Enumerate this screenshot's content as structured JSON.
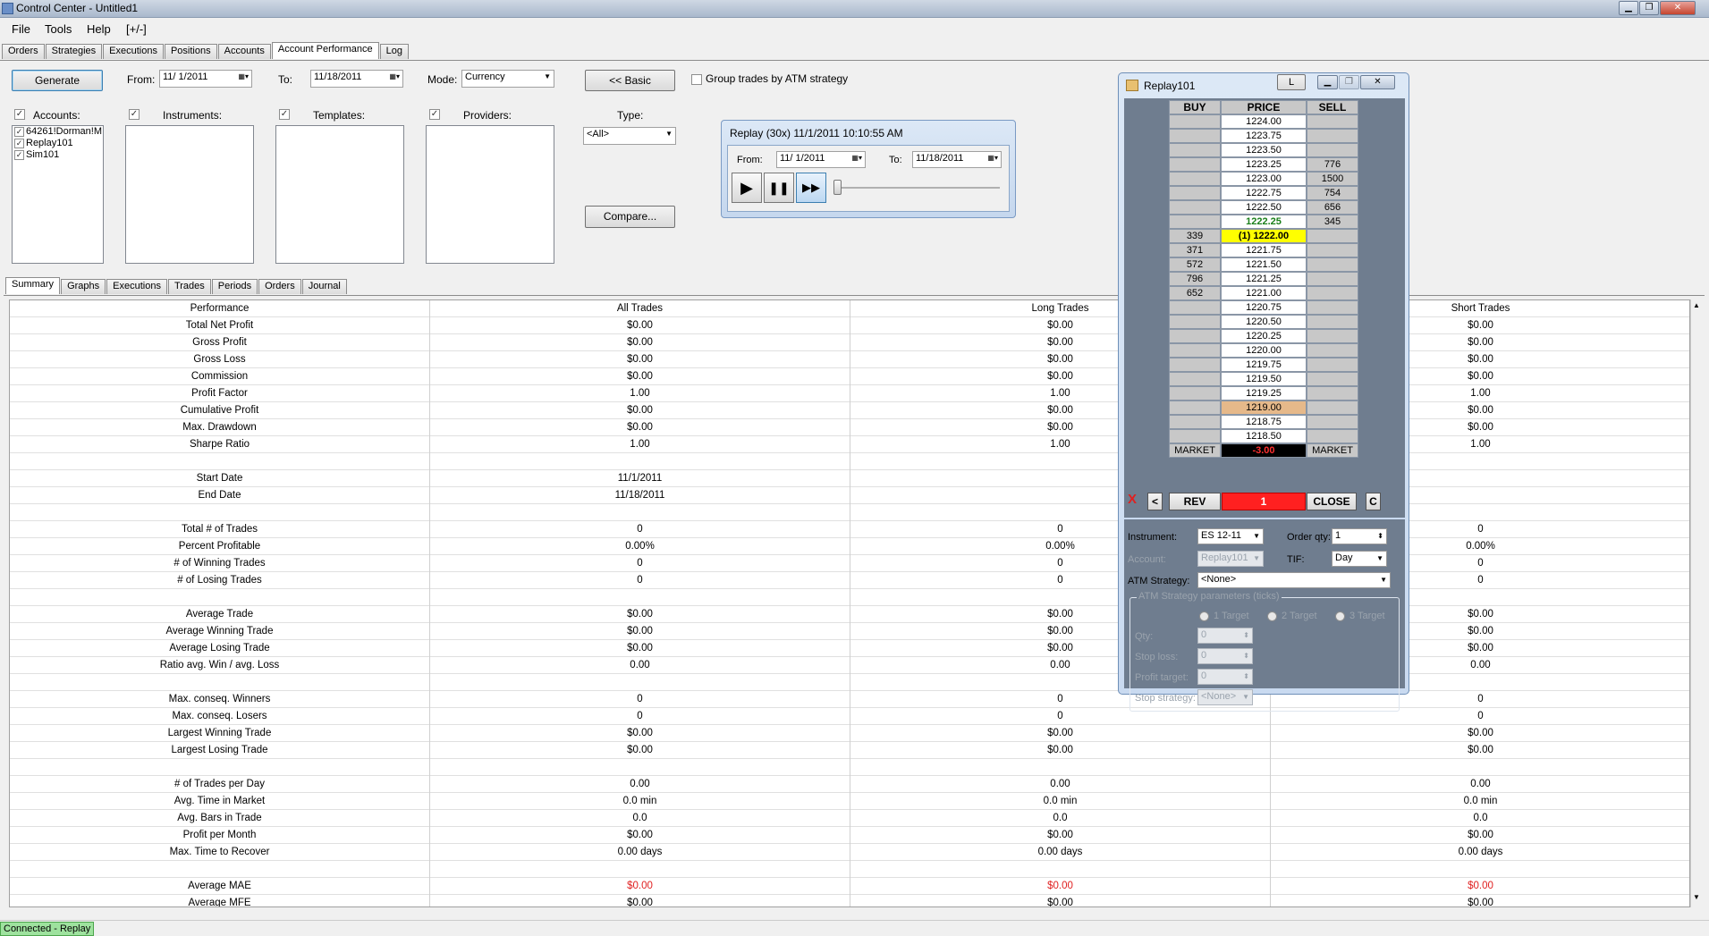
{
  "window": {
    "title": "Control Center - Untitled1",
    "min": "▁",
    "max": "❐",
    "close": "✕"
  },
  "menu": [
    "File",
    "Tools",
    "Help",
    "[+/-]"
  ],
  "main_tabs": [
    "Orders",
    "Strategies",
    "Executions",
    "Positions",
    "Accounts",
    "Account Performance",
    "Log"
  ],
  "toolbar": {
    "generate": "Generate",
    "from_label": "From:",
    "from_value": "11/ 1/2011",
    "to_label": "To:",
    "to_value": "11/18/2011",
    "mode_label": "Mode:",
    "mode_value": "Currency",
    "basic": "<< Basic",
    "group_trades": "Group trades by ATM strategy",
    "type_label": "Type:",
    "type_value": "<All>",
    "compare": "Compare..."
  },
  "filters": {
    "accounts_label": "Accounts:",
    "accounts": [
      "64261!Dorman!M",
      "Replay101",
      "Sim101"
    ],
    "instruments_label": "Instruments:",
    "templates_label": "Templates:",
    "providers_label": "Providers:"
  },
  "replay": {
    "title": "Replay (30x) 11/1/2011 10:10:55 AM",
    "from_label": "From:",
    "from_value": "11/ 1/2011",
    "to_label": "To:",
    "to_value": "11/18/2011",
    "play": "▶",
    "pause": "❚❚",
    "ffwd": "▶▶"
  },
  "sub_tabs": [
    "Summary",
    "Graphs",
    "Executions",
    "Trades",
    "Periods",
    "Orders",
    "Journal"
  ],
  "summary": {
    "headers": [
      "Performance",
      "All Trades",
      "Long Trades",
      "",
      "Short Trades"
    ],
    "rows": [
      [
        "Total Net Profit",
        "$0.00",
        "$0.00",
        "$0.00"
      ],
      [
        "Gross Profit",
        "$0.00",
        "$0.00",
        "$0.00"
      ],
      [
        "Gross Loss",
        "$0.00",
        "$0.00",
        "$0.00"
      ],
      [
        "Commission",
        "$0.00",
        "$0.00",
        "$0.00"
      ],
      [
        "Profit Factor",
        "1.00",
        "1.00",
        "1.00"
      ],
      [
        "Cumulative Profit",
        "$0.00",
        "$0.00",
        "$0.00"
      ],
      [
        "Max. Drawdown",
        "$0.00",
        "$0.00",
        "$0.00"
      ],
      [
        "Sharpe Ratio",
        "1.00",
        "1.00",
        "1.00"
      ],
      [
        "",
        "",
        "",
        ""
      ],
      [
        "Start Date",
        "11/1/2011",
        "",
        ""
      ],
      [
        "End Date",
        "11/18/2011",
        "",
        ""
      ],
      [
        "",
        "",
        "",
        ""
      ],
      [
        "Total # of Trades",
        "0",
        "0",
        "0"
      ],
      [
        "Percent Profitable",
        "0.00%",
        "0.00%",
        "0.00%"
      ],
      [
        "# of Winning Trades",
        "0",
        "0",
        "0"
      ],
      [
        "# of Losing Trades",
        "0",
        "0",
        "0"
      ],
      [
        "",
        "",
        "",
        ""
      ],
      [
        "Average Trade",
        "$0.00",
        "$0.00",
        "$0.00"
      ],
      [
        "Average Winning Trade",
        "$0.00",
        "$0.00",
        "$0.00"
      ],
      [
        "Average Losing Trade",
        "$0.00",
        "$0.00",
        "$0.00"
      ],
      [
        "Ratio avg. Win / avg. Loss",
        "0.00",
        "0.00",
        "0.00"
      ],
      [
        "",
        "",
        "",
        ""
      ],
      [
        "Max. conseq. Winners",
        "0",
        "0",
        "0"
      ],
      [
        "Max. conseq. Losers",
        "0",
        "0",
        "0"
      ],
      [
        "Largest Winning Trade",
        "$0.00",
        "$0.00",
        "$0.00"
      ],
      [
        "Largest Losing Trade",
        "$0.00",
        "$0.00",
        "$0.00"
      ],
      [
        "",
        "",
        "",
        ""
      ],
      [
        "# of Trades per Day",
        "0.00",
        "0.00",
        "0.00"
      ],
      [
        "Avg. Time in Market",
        "0.0 min",
        "0.0 min",
        "0.0 min"
      ],
      [
        "Avg. Bars in Trade",
        "0.0",
        "0.0",
        "0.0"
      ],
      [
        "Profit per Month",
        "$0.00",
        "$0.00",
        "$0.00"
      ],
      [
        "Max. Time to Recover",
        "0.00 days",
        "0.00 days",
        "0.00 days"
      ],
      [
        "",
        "",
        "",
        ""
      ],
      [
        "Average MAE",
        "$0.00",
        "$0.00",
        "$0.00"
      ],
      [
        "Average MFE",
        "$0.00",
        "$0.00",
        "$0.00"
      ]
    ],
    "red_rows": [
      33
    ]
  },
  "status": {
    "connection": "Connected - Replay"
  },
  "dom": {
    "title": "Replay101",
    "link_button": "L",
    "headers": [
      "BUY",
      "PRICE",
      "SELL"
    ],
    "ladder": [
      {
        "buy": "",
        "price": "1224.00",
        "sell": "",
        "style": "white"
      },
      {
        "buy": "",
        "price": "1223.75",
        "sell": "",
        "style": "white"
      },
      {
        "buy": "",
        "price": "1223.50",
        "sell": "",
        "style": "white"
      },
      {
        "buy": "",
        "price": "1223.25",
        "sell": "776",
        "style": "white"
      },
      {
        "buy": "",
        "price": "1223.00",
        "sell": "1500",
        "style": "white"
      },
      {
        "buy": "",
        "price": "1222.75",
        "sell": "754",
        "style": "white"
      },
      {
        "buy": "",
        "price": "1222.50",
        "sell": "656",
        "style": "white"
      },
      {
        "buy": "",
        "price": "1222.25",
        "sell": "345",
        "style": "green"
      },
      {
        "buy": "339",
        "price": "(1) 1222.00",
        "sell": "",
        "style": "yellow"
      },
      {
        "buy": "371",
        "price": "1221.75",
        "sell": "",
        "style": "white"
      },
      {
        "buy": "572",
        "price": "1221.50",
        "sell": "",
        "style": "white"
      },
      {
        "buy": "796",
        "price": "1221.25",
        "sell": "",
        "style": "white"
      },
      {
        "buy": "652",
        "price": "1221.00",
        "sell": "",
        "style": "white"
      },
      {
        "buy": "",
        "price": "1220.75",
        "sell": "",
        "style": "white"
      },
      {
        "buy": "",
        "price": "1220.50",
        "sell": "",
        "style": "white"
      },
      {
        "buy": "",
        "price": "1220.25",
        "sell": "",
        "style": "white"
      },
      {
        "buy": "",
        "price": "1220.00",
        "sell": "",
        "style": "white"
      },
      {
        "buy": "",
        "price": "1219.75",
        "sell": "",
        "style": "white"
      },
      {
        "buy": "",
        "price": "1219.50",
        "sell": "",
        "style": "white"
      },
      {
        "buy": "",
        "price": "1219.25",
        "sell": "",
        "style": "white"
      },
      {
        "buy": "",
        "price": "1219.00",
        "sell": "",
        "style": "tan"
      },
      {
        "buy": "",
        "price": "1218.75",
        "sell": "",
        "style": "white"
      },
      {
        "buy": "",
        "price": "1218.50",
        "sell": "",
        "style": "white"
      }
    ],
    "market_buy": "MARKET",
    "pnl": "-3.00",
    "market_sell": "MARKET",
    "x": "X",
    "lt": "<",
    "rev": "REV",
    "position_qty": "1",
    "close": "CLOSE",
    "c": "C",
    "instrument_label": "Instrument:",
    "instrument_value": "ES 12-11",
    "order_qty_label": "Order qty:",
    "order_qty_value": "1",
    "account_label": "Account:",
    "account_value": "Replay101",
    "tif_label": "TIF:",
    "tif_value": "Day",
    "atm_label": "ATM Strategy:",
    "atm_value": "<None>",
    "atm_params_label": "ATM Strategy parameters (ticks)",
    "targets": [
      "1 Target",
      "2 Target",
      "3 Target"
    ],
    "qty_label": "Qty:",
    "qty_value": "0",
    "stop_loss_label": "Stop loss:",
    "stop_loss_value": "0",
    "profit_target_label": "Profit target:",
    "profit_target_value": "0",
    "stop_strategy_label": "Stop strategy:",
    "stop_strategy_value": "<None>"
  }
}
